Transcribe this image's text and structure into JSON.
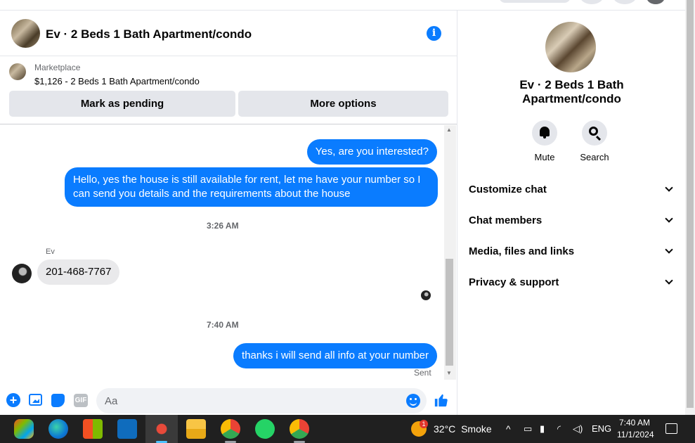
{
  "chat": {
    "title": "Ev · 2 Beds 1 Bath Apartment/condo",
    "listing": {
      "source": "Marketplace",
      "price_title": "$1,126 - 2 Beds 1 Bath Apartment/condo"
    },
    "buttons": {
      "mark_pending": "Mark as pending",
      "more_options": "More options"
    },
    "messages": [
      {
        "direction": "out",
        "text": "Yes, are you interested?"
      },
      {
        "direction": "out",
        "text": "Hello, yes the house is still available for rent, let me have your number so I can send you details and the requirements about the house"
      },
      {
        "type": "timestamp",
        "text": "3:26 AM"
      },
      {
        "direction": "in",
        "sender": "Ev",
        "text": "201-468-7767"
      },
      {
        "type": "timestamp",
        "text": "7:40 AM"
      },
      {
        "direction": "out",
        "text": "thanks i will send all info at your number"
      }
    ],
    "status": "Sent",
    "composer": {
      "placeholder": "Aa",
      "value": "",
      "gif_label": "GIF"
    }
  },
  "info_panel": {
    "title_line1": "Ev · 2 Beds 1 Bath",
    "title_line2": "Apartment/condo",
    "actions": [
      {
        "label": "Mute",
        "icon": "bell-icon"
      },
      {
        "label": "Search",
        "icon": "search-icon"
      }
    ],
    "sections": [
      "Customize chat",
      "Chat members",
      "Media, files and links",
      "Privacy & support"
    ]
  },
  "taskbar": {
    "weather": {
      "temperature": "32°C",
      "condition": "Smoke",
      "badge": "1"
    },
    "language": "ENG",
    "time": "7:40 AM",
    "date": "11/1/2024",
    "apps": [
      "copilot-icon",
      "edge-icon",
      "store-icon",
      "outlook-icon",
      "app-icon",
      "file-explorer-icon",
      "chrome-icon",
      "whatsapp-icon",
      "chrome-profile-icon"
    ]
  },
  "colors": {
    "accent": "#0a7cff",
    "bubble_in": "#e9e9eb",
    "button_bg": "#e4e6eb",
    "taskbar_bg": "#202020"
  }
}
